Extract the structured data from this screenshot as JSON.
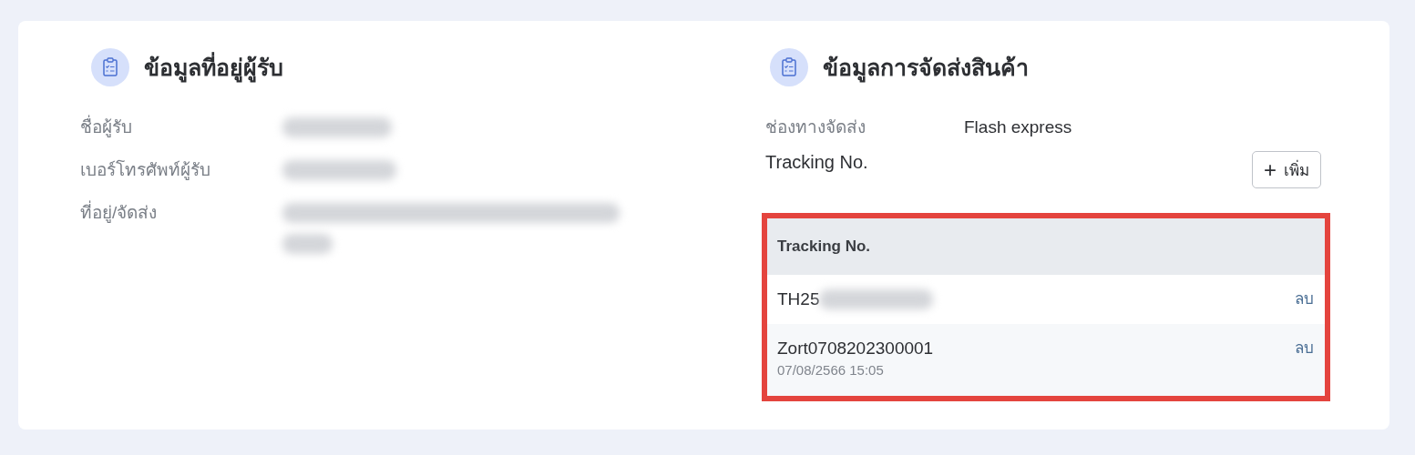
{
  "recipient": {
    "title": "ข้อมูลที่อยู่ผู้รับ",
    "fields": [
      {
        "label": "ชื่อผู้รับ",
        "blurred": true
      },
      {
        "label": "เบอร์โทรศัพท์ผู้รับ",
        "blurred": true
      },
      {
        "label": "ที่อยู่/จัดส่ง",
        "blurred": true
      }
    ]
  },
  "shipping": {
    "title": "ข้อมูลการจัดส่งสินค้า",
    "fields": [
      {
        "label": "ช่องทางจัดส่ง",
        "value": "Flash express"
      }
    ],
    "tracking_label": "Tracking No.",
    "add_button": {
      "icon": "+",
      "label": "เพิ่ม"
    },
    "table": {
      "highlighted": true,
      "columns": [
        "Tracking No."
      ],
      "rows": [
        {
          "tracking": "TH25",
          "blurred": true,
          "action": "ลบ"
        },
        {
          "tracking": "Zort0708202300001",
          "date": "07/08/2566 15:05",
          "blurred": false,
          "action": "ลบ"
        }
      ]
    }
  }
}
